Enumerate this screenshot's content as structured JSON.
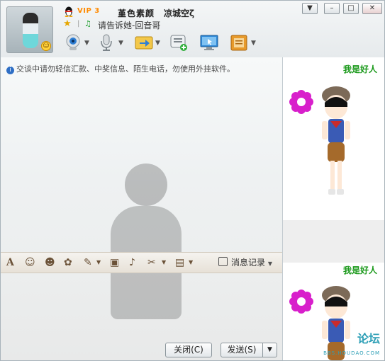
{
  "header": {
    "vip_label": "VIP 3",
    "nickname": "堇色素颜",
    "remark": "凉城空ζ",
    "status_text": "请告诉她-回音哥"
  },
  "window_controls": {
    "menu": "▼",
    "minimize": "–",
    "maximize": "□",
    "close": "✕"
  },
  "toolbar_icons": [
    "camera-icon",
    "microphone-icon",
    "file-transfer-icon",
    "message-apps-icon",
    "remote-assist-icon",
    "apps-box-icon"
  ],
  "chat": {
    "notice": "交谈中请勿轻信汇款、中奖信息、陌生电话，勿使用外挂软件。"
  },
  "input_toolbar": {
    "history_label": "消息记录"
  },
  "footer": {
    "close_label": "关闭(C)",
    "send_label": "发送(S)"
  },
  "right_panel": {
    "banner_top": "我是好人",
    "banner_bottom": "我是好人",
    "watermark": "论坛",
    "watermark_sub": "BBS.HOUDAO.COM"
  },
  "colors": {
    "accent_orange": "#ff8a00",
    "flower_magenta": "#d81fcb",
    "banner_red": "#e02020",
    "banner_green": "#1c9a1c"
  }
}
